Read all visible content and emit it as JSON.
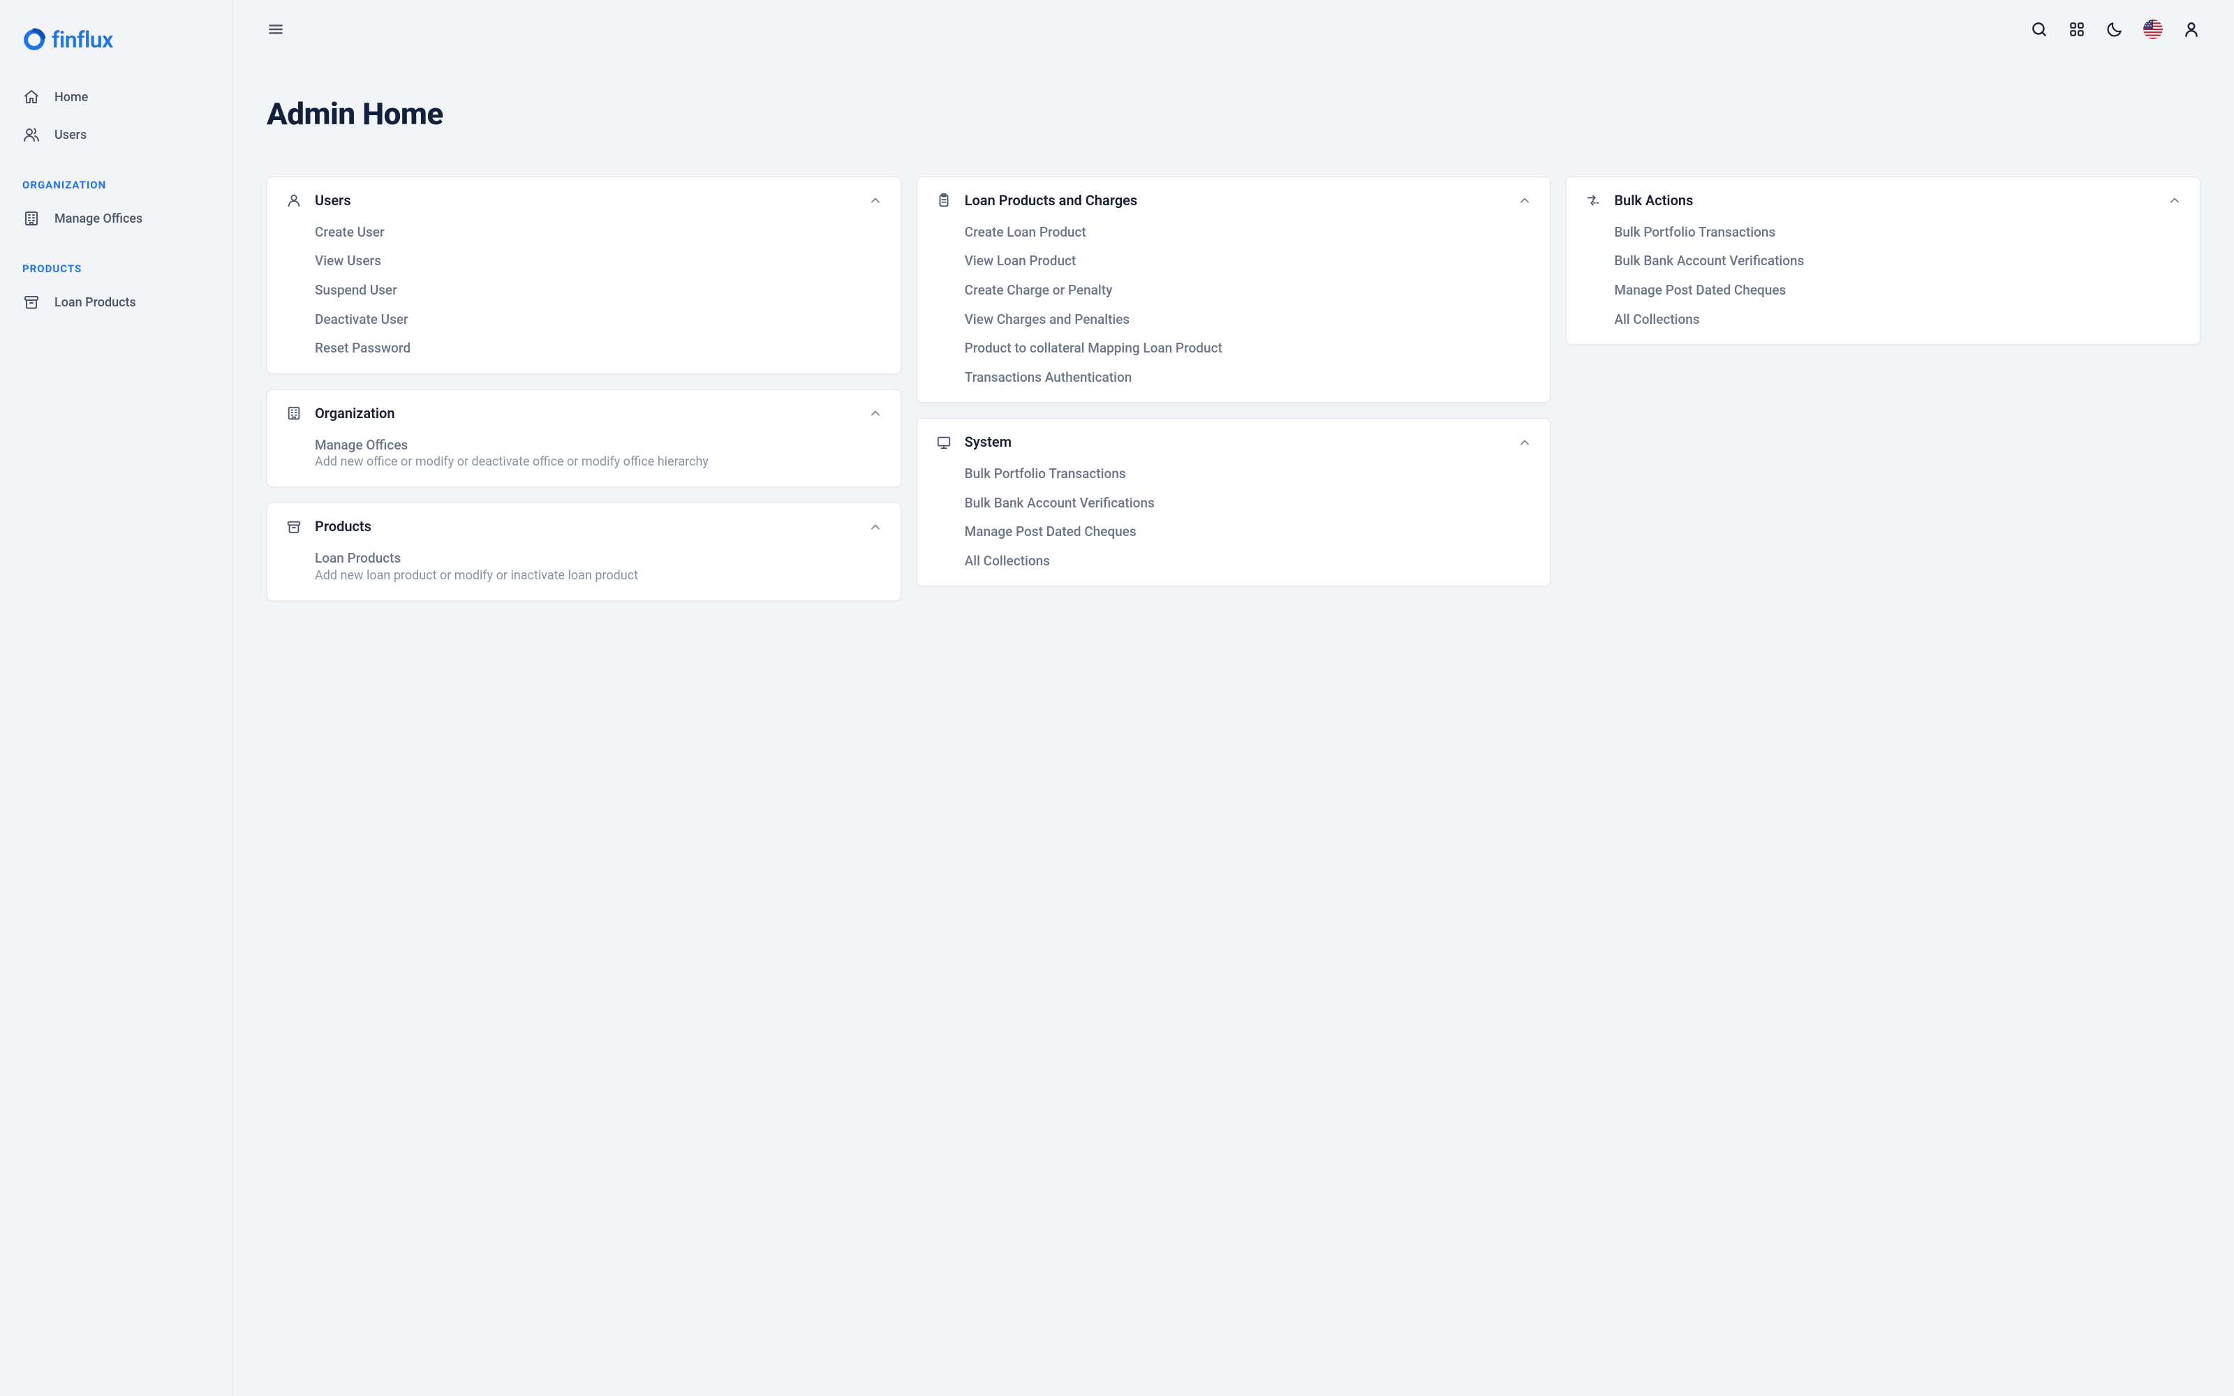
{
  "brand": {
    "name": "finflux"
  },
  "sidebar": {
    "primary": [
      {
        "label": "Home",
        "icon": "home-icon"
      },
      {
        "label": "Users",
        "icon": "users-icon"
      }
    ],
    "sections": [
      {
        "title": "ORGANIZATION",
        "items": [
          {
            "label": "Manage Offices",
            "icon": "office-icon"
          }
        ]
      },
      {
        "title": "PRODUCTS",
        "items": [
          {
            "label": "Loan Products",
            "icon": "archive-icon"
          }
        ]
      }
    ]
  },
  "header": {
    "title": "Admin Home"
  },
  "columns": [
    {
      "cards": [
        {
          "title": "Users",
          "icon": "user-icon",
          "items": [
            {
              "label": "Create User"
            },
            {
              "label": "View Users"
            },
            {
              "label": "Suspend User"
            },
            {
              "label": "Deactivate User"
            },
            {
              "label": "Reset Password"
            }
          ]
        },
        {
          "title": "Organization",
          "icon": "office-icon",
          "items": [
            {
              "label": "Manage Offices",
              "sub": "Add new office or modify or deactivate office or modify office hierarchy"
            }
          ]
        },
        {
          "title": "Products",
          "icon": "archive-icon",
          "items": [
            {
              "label": "Loan Products",
              "sub": "Add new loan product or modify or inactivate loan product"
            }
          ]
        }
      ]
    },
    {
      "cards": [
        {
          "title": "Loan Products and Charges",
          "icon": "clipboard-icon",
          "items": [
            {
              "label": "Create Loan Product"
            },
            {
              "label": "View Loan Product"
            },
            {
              "label": "Create Charge or Penalty"
            },
            {
              "label": "View Charges and Penalties"
            },
            {
              "label": "Product to collateral Mapping Loan Product"
            },
            {
              "label": "Transactions Authentication"
            }
          ]
        },
        {
          "title": "System",
          "icon": "monitor-icon",
          "items": [
            {
              "label": "Bulk Portfolio Transactions"
            },
            {
              "label": "Bulk Bank Account Verifications"
            },
            {
              "label": "Manage Post Dated Cheques"
            },
            {
              "label": "All Collections"
            }
          ]
        }
      ]
    },
    {
      "cards": [
        {
          "title": "Bulk Actions",
          "icon": "transfer-icon",
          "items": [
            {
              "label": "Bulk Portfolio Transactions"
            },
            {
              "label": "Bulk Bank Account Verifications"
            },
            {
              "label": "Manage Post Dated Cheques"
            },
            {
              "label": "All Collections"
            }
          ]
        }
      ]
    }
  ]
}
